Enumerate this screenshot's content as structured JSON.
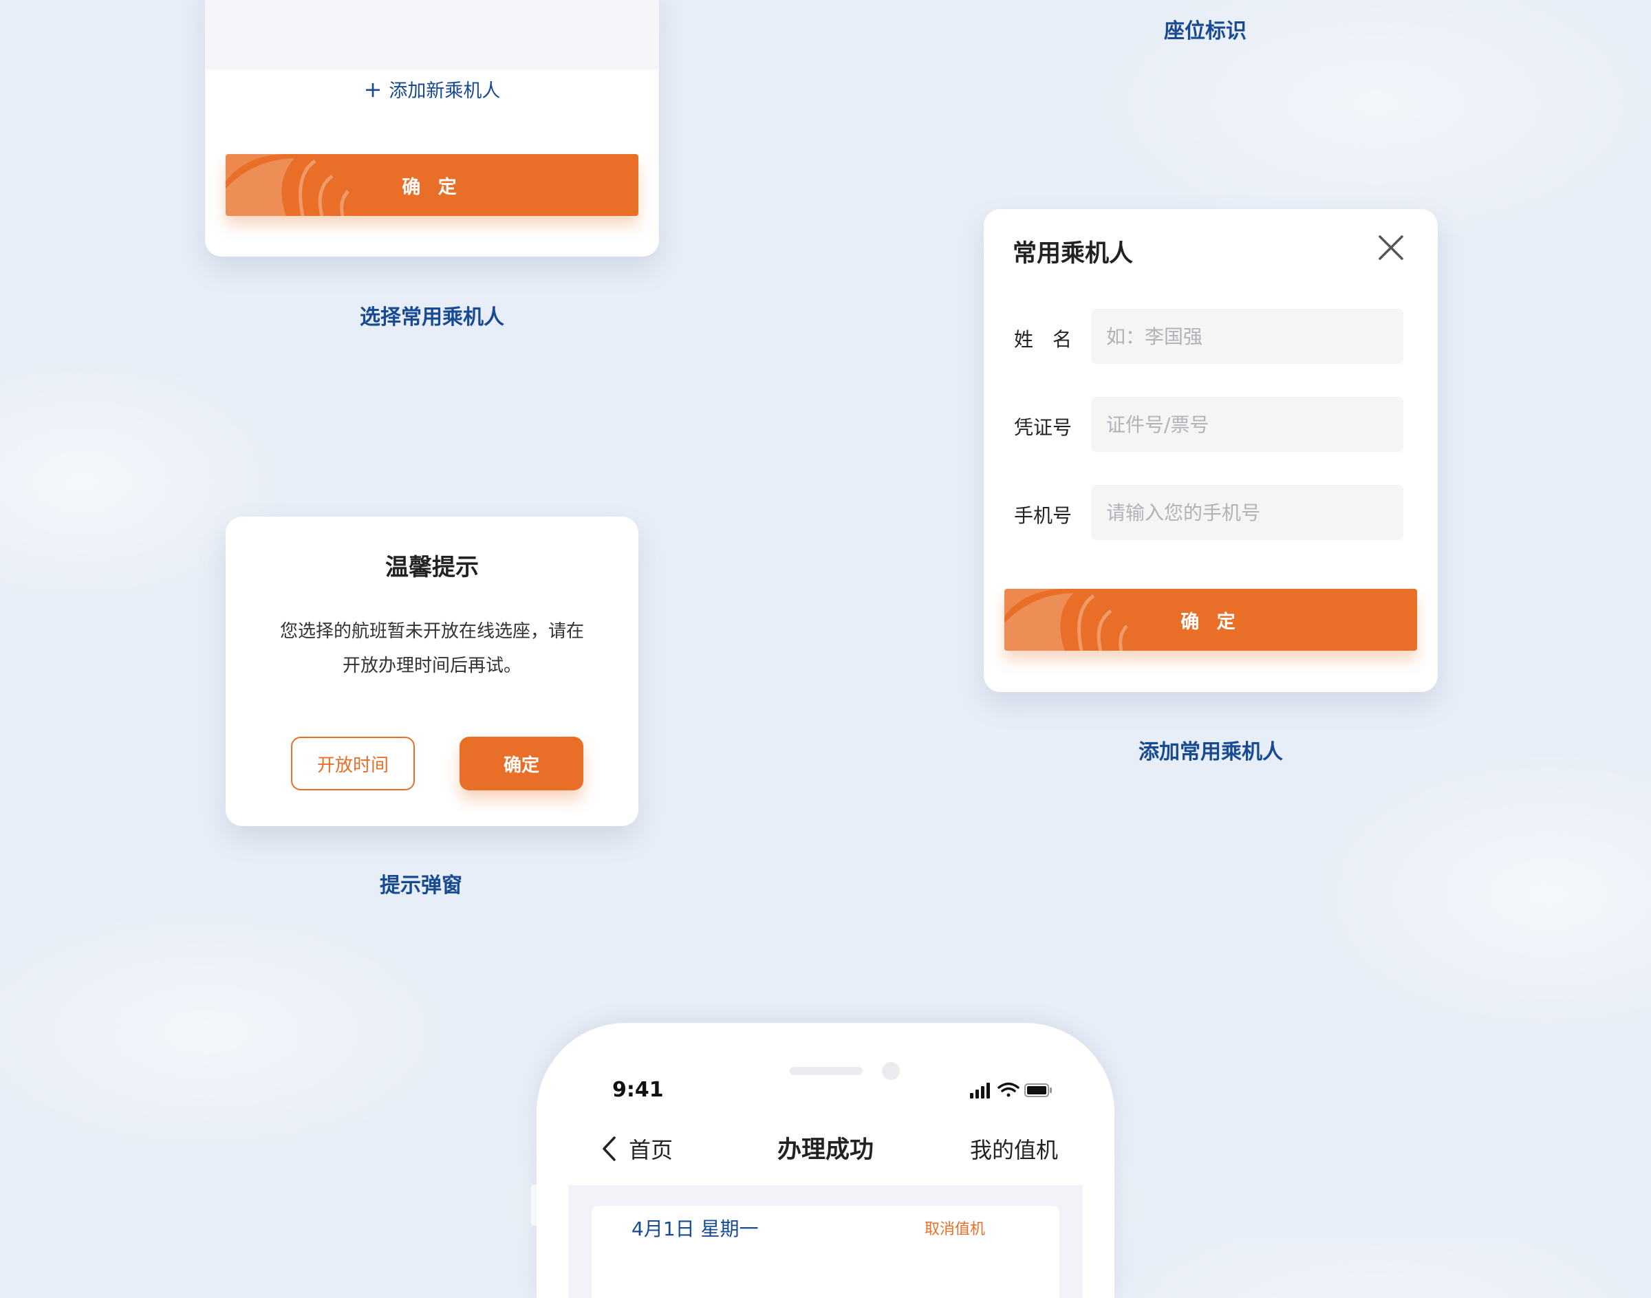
{
  "colors": {
    "brand_orange": "#e96f28",
    "brand_blue": "#174a91",
    "background": "#e8eef7"
  },
  "captions": {
    "seat_label": "座位标识",
    "select_passenger": "选择常用乘机人",
    "add_passenger": "添加常用乘机人",
    "tip_dialog": "提示弹窗"
  },
  "select_card": {
    "add_new_icon": "plus-icon",
    "add_new": "添加新乘机人",
    "confirm": "确 定"
  },
  "add_card": {
    "title": "常用乘机人",
    "close_icon": "close-icon",
    "fields": [
      {
        "label": "姓　名",
        "placeholder": "如：李国强",
        "value": ""
      },
      {
        "label": "凭证号",
        "placeholder": "证件号/票号",
        "value": ""
      },
      {
        "label": "手机号",
        "placeholder": "请输入您的手机号",
        "value": ""
      }
    ],
    "confirm": "确 定"
  },
  "tip_card": {
    "title": "温馨提示",
    "body_line1": "您选择的航班暂未开放在线选座，请在",
    "body_line2": "开放办理时间后再试。",
    "open_time": "开放时间",
    "confirm": "确定"
  },
  "phone": {
    "status_time": "9:41",
    "status_icons": [
      "signal-icon",
      "wifi-icon",
      "battery-icon"
    ],
    "nav_back": "首页",
    "nav_title": "办理成功",
    "nav_right": "我的值机",
    "flight_date": "4月1日 星期一",
    "cancel_checkin": "取消值机"
  }
}
